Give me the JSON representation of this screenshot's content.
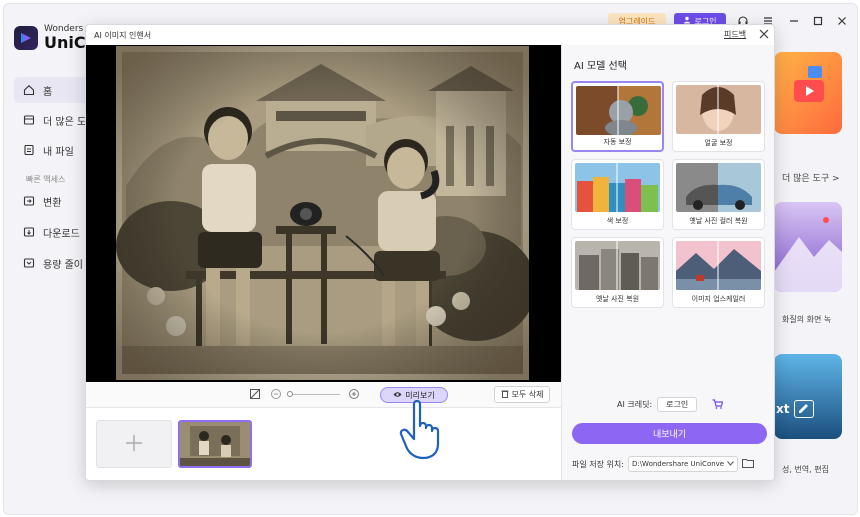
{
  "app": {
    "logo_line1": "Wonders",
    "logo_line2": "UniC",
    "upgrade_label": "업그레이드",
    "login_label": "로그인"
  },
  "sidebar": {
    "items": [
      {
        "label": "홈",
        "icon": "home-icon"
      },
      {
        "label": "더 많은 도",
        "icon": "grid-icon"
      },
      {
        "label": "내 파일",
        "icon": "file-icon"
      }
    ],
    "section_label": "빠른 액세스",
    "quick_items": [
      {
        "label": "변환",
        "icon": "convert-icon"
      },
      {
        "label": "다운로드",
        "icon": "download-icon"
      },
      {
        "label": "용량 줄이",
        "icon": "compress-icon"
      }
    ]
  },
  "background": {
    "more_tools": "더 많은 도구 >",
    "text_1": "화질의 화면 녹",
    "text_2": "성, 번역, 편집",
    "card_text": "xt"
  },
  "modal": {
    "title": "AI 이미지 인핸서",
    "feedback": "피드백",
    "panel_title": "AI 모델 선택",
    "models": [
      {
        "label": "자동 보정"
      },
      {
        "label": "얼굴 보정"
      },
      {
        "label": "색 보정"
      },
      {
        "label": "옛날 사진 컬러 복원"
      },
      {
        "label": "옛날 사진 복원"
      },
      {
        "label": "이미지 업스케일러"
      }
    ],
    "preview_label": "미리보기",
    "delete_all_label": "모두 삭제",
    "credit_label": "AI 크레딧:",
    "credit_login": "로그인",
    "export_label": "내보내기",
    "save_location_label": "파일 저장 위치:",
    "save_path": "D:\\Wondershare UniConve"
  },
  "colors": {
    "accent": "#8e66f4",
    "selected_border": "#9a86ee",
    "upgrade_bg": "#fde5c2",
    "login_bg": "#6e4de8"
  }
}
